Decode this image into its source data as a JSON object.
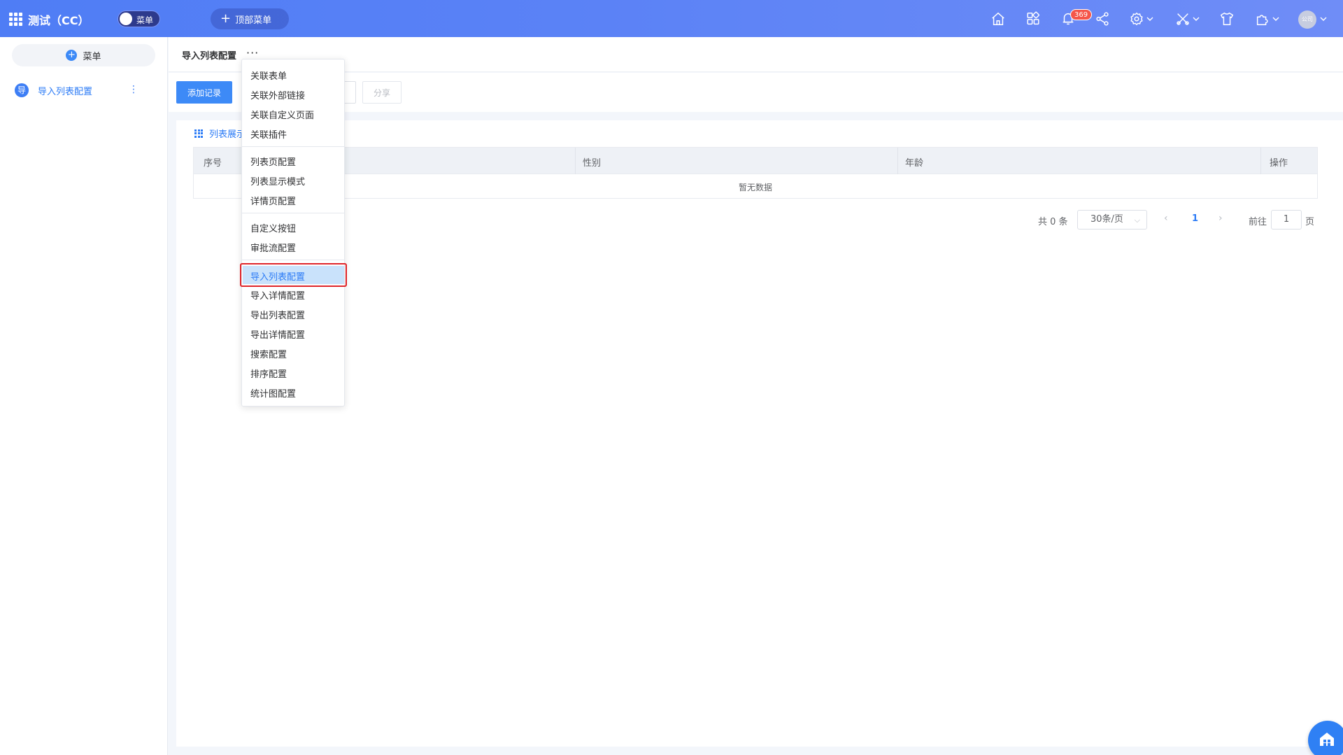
{
  "header": {
    "app_title": "测试（CC）",
    "toggle_label": "菜单",
    "top_menu_label": "顶部菜单",
    "notification_count": "369",
    "avatar_text": "公司"
  },
  "sidebar": {
    "menu_button_label": "菜单",
    "items": [
      {
        "icon_text": "导",
        "label": "导入列表配置",
        "active": true
      }
    ]
  },
  "page": {
    "title": "导入列表配置",
    "more": "···"
  },
  "toolbar": {
    "add_record_label": "添加记录",
    "share_label": "分享"
  },
  "view_tab": {
    "label": "列表展示"
  },
  "table": {
    "columns": [
      "序号",
      "性别",
      "年龄",
      "操作"
    ],
    "empty_text": "暂无数据"
  },
  "pagination": {
    "total_text": "共 0 条",
    "page_size": "30条/页",
    "current_page": "1",
    "goto_label": "前往",
    "goto_value": "1",
    "page_unit": "页"
  },
  "dropdown": {
    "groups": [
      [
        "关联表单",
        "关联外部链接",
        "关联自定义页面",
        "关联插件"
      ],
      [
        "列表页配置",
        "列表显示模式",
        "详情页配置"
      ],
      [
        "自定义按钮",
        "审批流配置"
      ],
      [
        "导入列表配置",
        "导入详情配置",
        "导出列表配置",
        "导出详情配置",
        "搜索配置",
        "排序配置",
        "统计图配置"
      ]
    ],
    "selected": "导入列表配置"
  },
  "colors": {
    "header_start": "#4f7df5",
    "primary": "#3d8af7",
    "highlight_border": "#e0252a",
    "highlight_fill": "#c9e2fb"
  },
  "icons": [
    "apps-grid-icon",
    "plus-icon",
    "home-icon",
    "apps-icon",
    "bell-icon",
    "share-icon",
    "gear-icon",
    "tools-icon",
    "shirt-icon",
    "plugin-icon",
    "chevron-down-icon",
    "home-fab-icon"
  ]
}
